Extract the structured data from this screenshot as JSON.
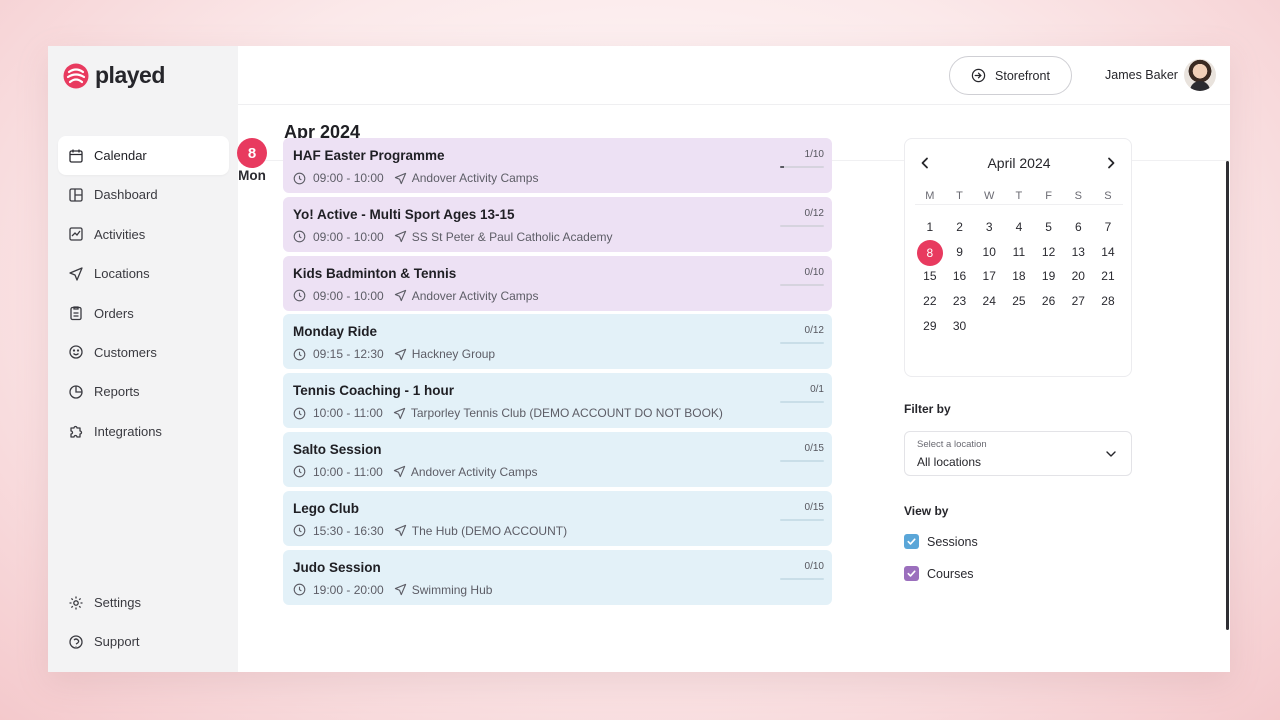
{
  "app": {
    "name": "played",
    "brand_color": "#e83a5f"
  },
  "sidebar": {
    "items": [
      {
        "label": "Calendar",
        "icon": "calendar-icon",
        "active": true
      },
      {
        "label": "Dashboard",
        "icon": "dashboard-icon"
      },
      {
        "label": "Activities",
        "icon": "activities-icon"
      },
      {
        "label": "Locations",
        "icon": "location-arrow-icon"
      },
      {
        "label": "Orders",
        "icon": "clipboard-icon"
      },
      {
        "label": "Customers",
        "icon": "smiley-icon"
      },
      {
        "label": "Reports",
        "icon": "pie-chart-icon"
      },
      {
        "label": "Integrations",
        "icon": "puzzle-icon"
      }
    ],
    "bottom_items": [
      {
        "label": "Settings",
        "icon": "gear-icon"
      },
      {
        "label": "Support",
        "icon": "support-icon"
      }
    ]
  },
  "topbar": {
    "storefront_label": "Storefront",
    "user_name": "James Baker"
  },
  "header": {
    "month_title": "Apr 2024"
  },
  "day": {
    "number": "8",
    "name": "Mon"
  },
  "events": [
    {
      "title": "HAF Easter Programme",
      "time": "09:00 - 10:00",
      "location": "Andover Activity Camps",
      "capacity": "1/10",
      "fill": 0.1,
      "kind": "course"
    },
    {
      "title": "Yo! Active - Multi Sport Ages 13-15",
      "time": "09:00 - 10:00",
      "location": "SS St Peter & Paul Catholic Academy",
      "capacity": "0/12",
      "fill": 0,
      "kind": "course"
    },
    {
      "title": "Kids Badminton & Tennis",
      "time": "09:00 - 10:00",
      "location": "Andover Activity Camps",
      "capacity": "0/10",
      "fill": 0,
      "kind": "course"
    },
    {
      "title": "Monday Ride",
      "time": "09:15 - 12:30",
      "location": "Hackney Group",
      "capacity": "0/12",
      "fill": 0,
      "kind": "session"
    },
    {
      "title": "Tennis Coaching - 1 hour",
      "time": "10:00 - 11:00",
      "location": "Tarporley Tennis Club (DEMO ACCOUNT DO NOT BOOK)",
      "capacity": "0/1",
      "fill": 0,
      "kind": "session"
    },
    {
      "title": "Salto Session",
      "time": "10:00 - 11:00",
      "location": "Andover Activity Camps",
      "capacity": "0/15",
      "fill": 0,
      "kind": "session"
    },
    {
      "title": "Lego Club",
      "time": "15:30 - 16:30",
      "location": "The Hub (DEMO ACCOUNT)",
      "capacity": "0/15",
      "fill": 0,
      "kind": "session"
    },
    {
      "title": "Judo Session",
      "time": "19:00 - 20:00",
      "location": "Swimming Hub",
      "capacity": "0/10",
      "fill": 0,
      "kind": "session"
    }
  ],
  "mini_calendar": {
    "title": "April 2024",
    "weekdays": [
      "M",
      "T",
      "W",
      "T",
      "F",
      "S",
      "S"
    ],
    "weeks": [
      [
        "1",
        "2",
        "3",
        "4",
        "5",
        "6",
        "7"
      ],
      [
        "8",
        "9",
        "10",
        "11",
        "12",
        "13",
        "14"
      ],
      [
        "15",
        "16",
        "17",
        "18",
        "19",
        "20",
        "21"
      ],
      [
        "22",
        "23",
        "24",
        "25",
        "26",
        "27",
        "28"
      ],
      [
        "29",
        "30",
        "",
        "",
        "",
        "",
        ""
      ]
    ],
    "selected": "8"
  },
  "filter": {
    "label": "Filter by",
    "select_caption": "Select a location",
    "select_value": "All locations"
  },
  "view_by": {
    "label": "View by",
    "options": [
      {
        "label": "Sessions",
        "checked": true,
        "color": "#5aa6d8"
      },
      {
        "label": "Courses",
        "checked": true,
        "color": "#9b6fbd"
      }
    ]
  }
}
